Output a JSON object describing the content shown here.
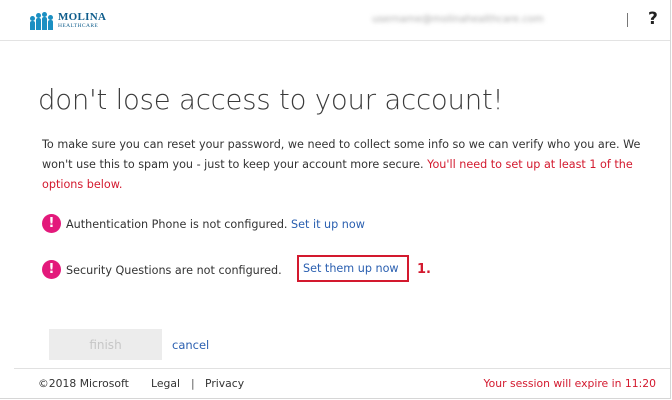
{
  "header": {
    "logo": {
      "brand": "MOLINA",
      "subtitle": "HEALTHCARE",
      "icon": "molina-people-icon",
      "color": "#1b8fc2"
    },
    "user_email": "username@molinahealthcare.com",
    "help_label": "?"
  },
  "main": {
    "title": "don't lose access to your account!",
    "intro_text": "To make sure you can reset your password, we need to collect some info so we can verify who you are. We won't use this to spam you - just to keep your account more secure.",
    "intro_warning": "You'll need to set up at least 1 of the options below.",
    "options": [
      {
        "icon": "exclamation-circle-icon",
        "text": "Authentication Phone is not configured.",
        "link": "Set it up now"
      },
      {
        "icon": "exclamation-circle-icon",
        "text": "Security Questions are not configured.",
        "link": "Set them up now"
      }
    ],
    "callout_number": "1.",
    "finish_label": "finish",
    "cancel_label": "cancel"
  },
  "footer": {
    "copyright": "©2018 Microsoft",
    "legal": "Legal",
    "separator": "|",
    "privacy": "Privacy",
    "session": "Your session will expire in 11:20"
  },
  "colors": {
    "accent_link": "#2a5fb0",
    "warning": "#d3192e",
    "alert_icon": "#e3197b"
  }
}
